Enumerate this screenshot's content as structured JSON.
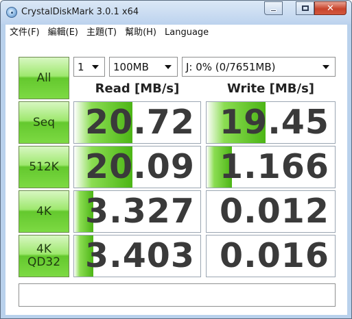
{
  "window": {
    "title": "CrystalDiskMark 3.0.1 x64",
    "minimize_glyph": "",
    "close_glyph": "✕"
  },
  "menu": {
    "items": [
      "文件(F)",
      "編輯(E)",
      "主題(T)",
      "幫助(H)",
      "Language"
    ]
  },
  "controls": {
    "all_label": "All",
    "runs_value": "1",
    "size_value": "100MB",
    "drive_value": "J: 0% (0/7651MB)"
  },
  "headers": {
    "read": "Read [MB/s]",
    "write": "Write [MB/s]"
  },
  "rows": [
    {
      "label": "Seq",
      "read": "20.72",
      "write": "19.45",
      "read_fill_fraction": 0.46,
      "write_fill_fraction": 0.46
    },
    {
      "label": "512K",
      "read": "20.09",
      "write": "1.166",
      "read_fill_fraction": 0.46,
      "write_fill_fraction": 0.2
    },
    {
      "label": "4K",
      "read": "3.327",
      "write": "0.012",
      "read_fill_fraction": 0.15,
      "write_fill_fraction": 0.0
    },
    {
      "label_line1": "4K",
      "label_line2": "QD32",
      "read": "3.403",
      "write": "0.016",
      "read_fill_fraction": 0.15,
      "write_fill_fraction": 0.0
    }
  ],
  "status": {
    "text": ""
  },
  "colors": {
    "bar_start": "#8bdd52",
    "bar_end": "#4cb515",
    "button_green": "#7dda43",
    "close_red": "#c8452c"
  },
  "icons": {
    "app": "crystaldiskmark-icon",
    "minimize": "minimize-icon",
    "maximize": "maximize-icon",
    "close": "close-icon",
    "dropdown": "chevron-down-icon"
  }
}
